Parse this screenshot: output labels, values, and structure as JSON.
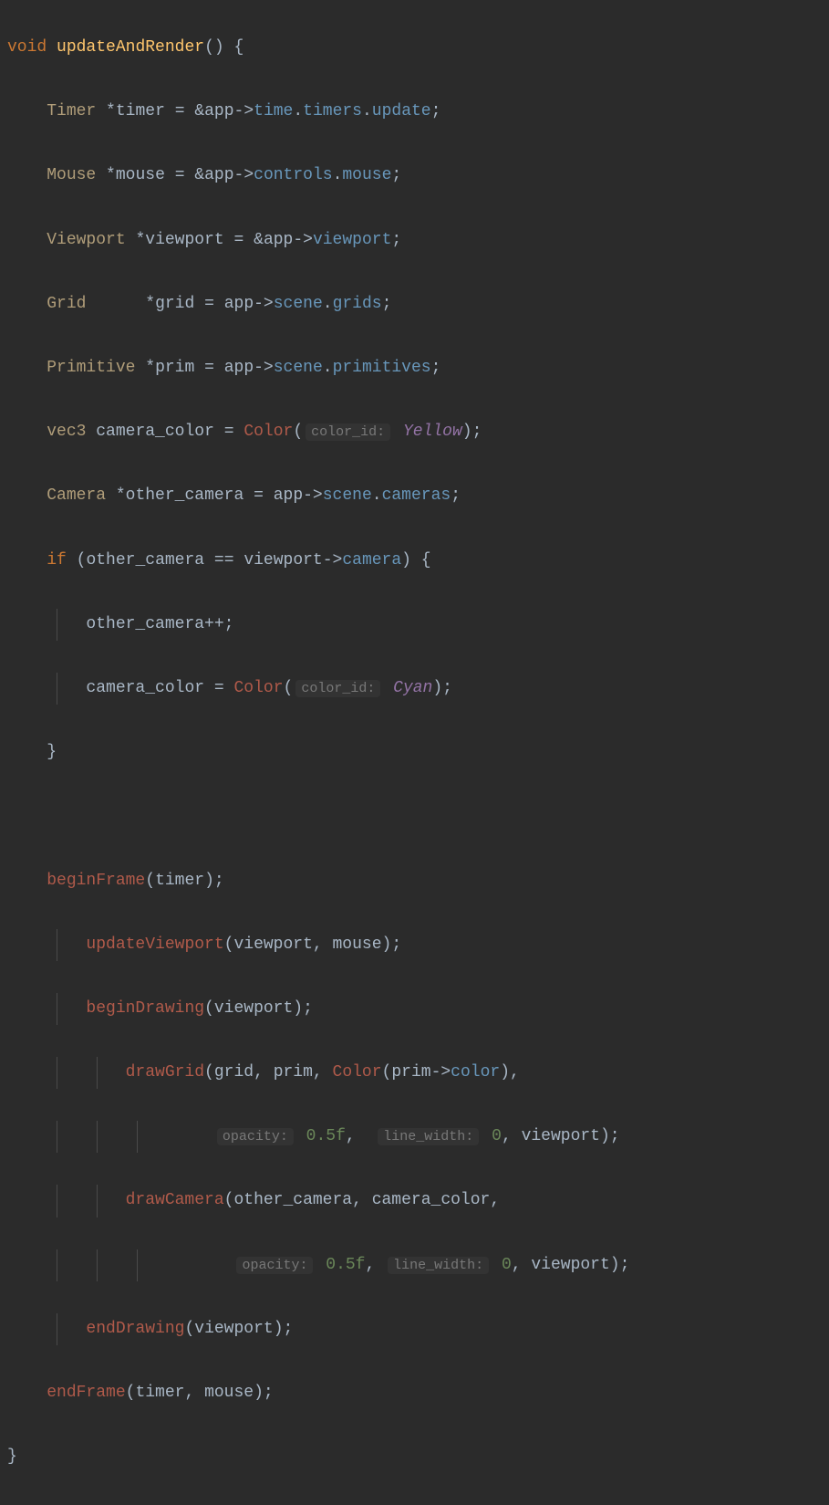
{
  "tokens": {
    "void": "void",
    "fnName": "updateAndRender",
    "Timer": "Timer",
    "timer": "timer",
    "app": "app",
    "time": "time",
    "timers": "timers",
    "update": "update",
    "Mouse": "Mouse",
    "mouse": "mouse",
    "controls": "controls",
    "mouseField": "mouse",
    "Viewport": "Viewport",
    "viewport": "viewport",
    "viewportField": "viewport",
    "Grid": "Grid",
    "grid": "grid",
    "scene": "scene",
    "grids": "grids",
    "Primitive": "Primitive",
    "prim": "prim",
    "primitives": "primitives",
    "vec3": "vec3",
    "camera_color": "camera_color",
    "Color": "Color",
    "hint_color_id": "color_id:",
    "Yellow": "Yellow",
    "Camera": "Camera",
    "other_camera": "other_camera",
    "cameras": "cameras",
    "if": "if",
    "eqop": "==",
    "cameraField": "camera",
    "Cyan": "Cyan",
    "beginFrame": "beginFrame",
    "updateViewport": "updateViewport",
    "beginDrawing": "beginDrawing",
    "drawGrid": "drawGrid",
    "colorField": "color",
    "hint_opacity": "opacity:",
    "v_05f": "0.5f",
    "hint_line_width": "line_width:",
    "v_0": "0",
    "drawCamera": "drawCamera",
    "endDrawing": "endDrawing",
    "endFrame": "endFrame"
  }
}
